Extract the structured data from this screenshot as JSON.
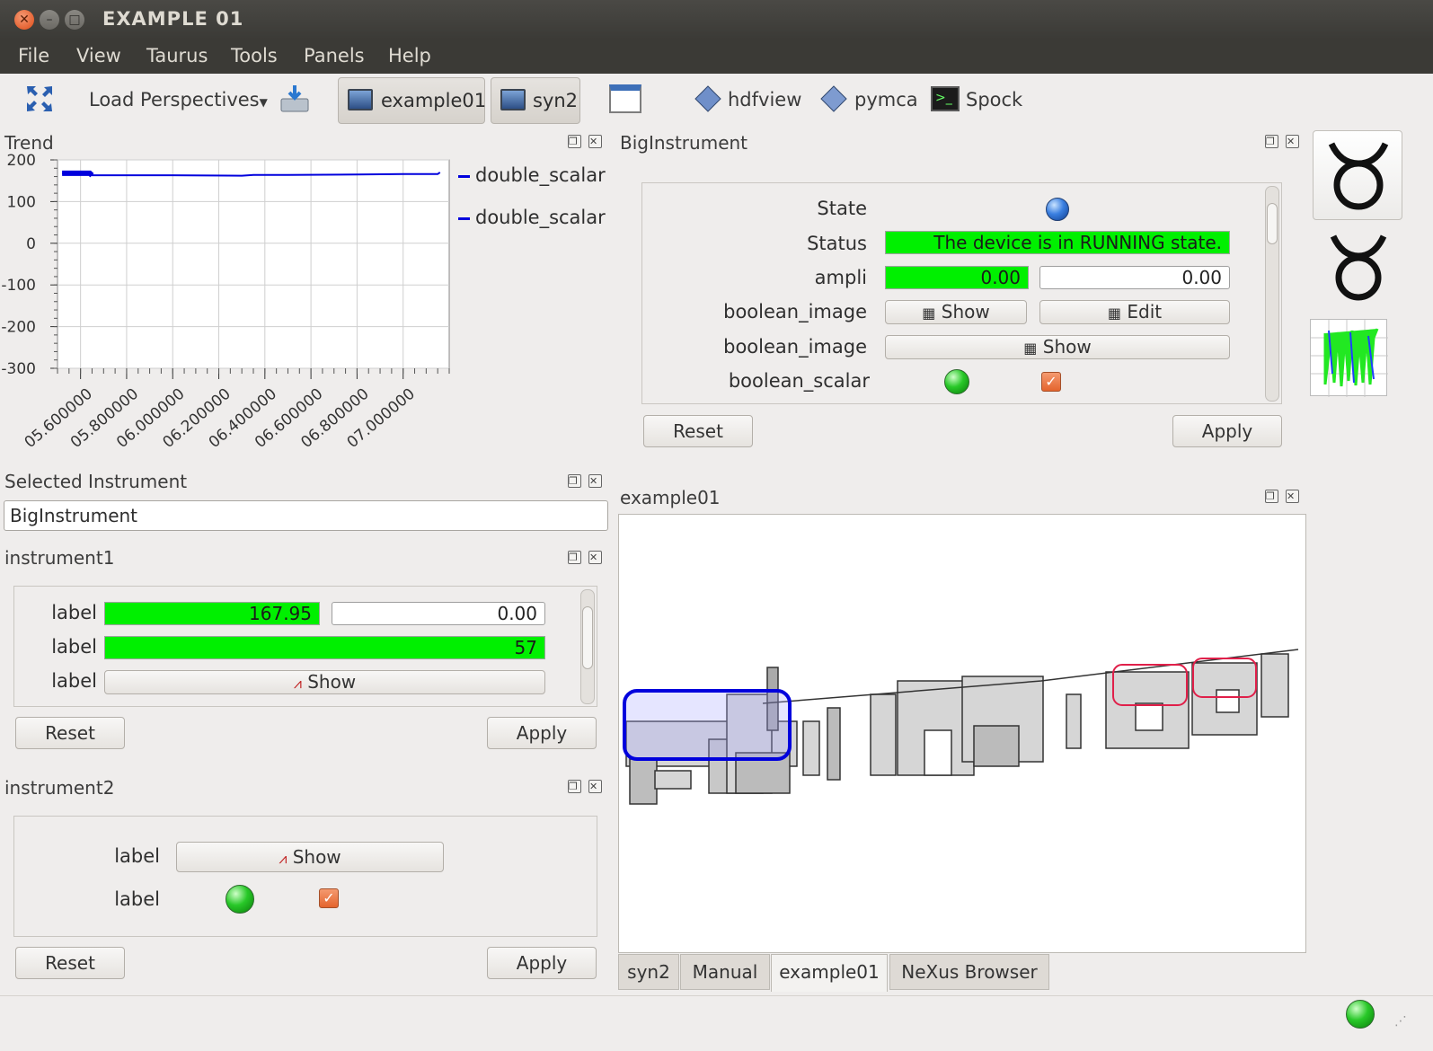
{
  "window": {
    "title": "EXAMPLE 01"
  },
  "menu": [
    "File",
    "View",
    "Taurus",
    "Tools",
    "Panels",
    "Help"
  ],
  "toolbar": {
    "load_perspectives": "Load Perspectives",
    "example01": "example01",
    "syn2": "syn2",
    "hdfview": "hdfview",
    "pymca": "pymca",
    "spock": "Spock"
  },
  "trend": {
    "title": "Trend",
    "legend": [
      "double_scalar",
      "double_scalar"
    ],
    "series_color": "#0000dd",
    "chart_data": {
      "type": "line",
      "title": "",
      "x_tick_labels": [
        "05.600000",
        "05.800000",
        "06.000000",
        "06.200000",
        "06.400000",
        "06.600000",
        "06.800000",
        "07.000000"
      ],
      "x": [
        5.52,
        5.64,
        5.65,
        5.77,
        6.0,
        6.3,
        6.35,
        6.5,
        6.8,
        7.0,
        7.15,
        7.16
      ],
      "series": [
        {
          "name": "double_scalar",
          "values": [
            168,
            168,
            163,
            163,
            163,
            162,
            164,
            164,
            165,
            166,
            166,
            170
          ]
        }
      ],
      "ylim": [
        -300,
        200
      ],
      "y_tick_labels": [
        "200",
        "100",
        "0",
        "-100",
        "-200",
        "-300"
      ],
      "xlim": [
        5.5,
        7.2
      ],
      "grid": true,
      "legend_position": "right"
    }
  },
  "big_instrument": {
    "title": "BigInstrument",
    "rows": {
      "state": "State",
      "status": "Status",
      "status_value": "The device is in RUNNING state.",
      "ampli": "ampli",
      "ampli_read": "0.00",
      "ampli_write": "0.00",
      "boolean_image_1": "boolean_image",
      "show_1": "Show",
      "edit": "Edit",
      "boolean_image_2": "boolean_image",
      "show_2": "Show",
      "boolean_scalar": "boolean_scalar"
    },
    "reset": "Reset",
    "apply": "Apply"
  },
  "selected_instrument": {
    "title": "Selected Instrument",
    "value": "BigInstrument"
  },
  "instrument1": {
    "title": "instrument1",
    "label1": "label",
    "read1": "167.95",
    "write1": "0.00",
    "label2": "label",
    "read2": "57",
    "label3": "label",
    "show": "Show",
    "reset": "Reset",
    "apply": "Apply"
  },
  "instrument2": {
    "title": "instrument2",
    "label1": "label",
    "show": "Show",
    "label2": "label",
    "reset": "Reset",
    "apply": "Apply"
  },
  "synoptic": {
    "title": "example01",
    "tabs": [
      "syn2",
      "Manual",
      "example01",
      "NeXus Browser"
    ],
    "selected_tab": "example01"
  },
  "colors": {
    "accent_green": "#00f000",
    "selection_blue": "#0000dd",
    "highlight_red": "#e0204a"
  }
}
